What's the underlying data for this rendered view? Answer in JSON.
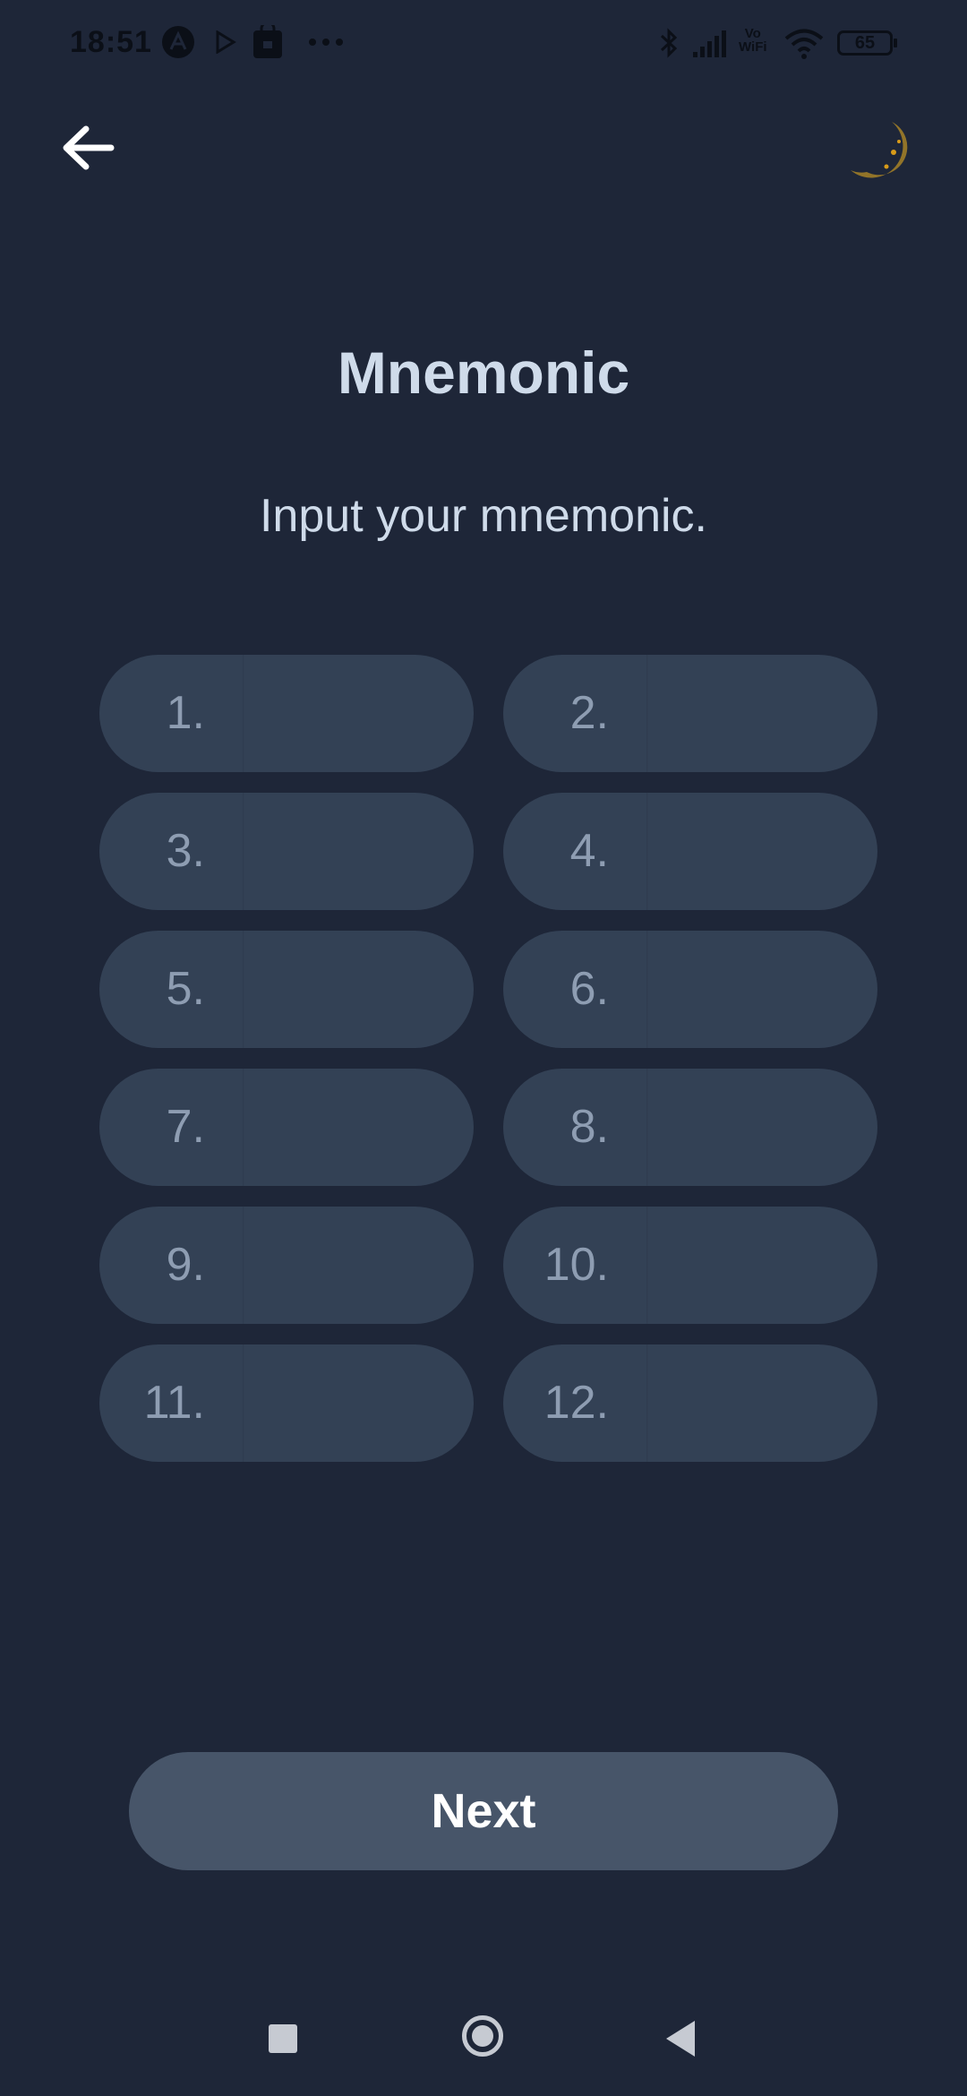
{
  "status_bar": {
    "time": "18:51",
    "battery": "65",
    "vowifi_line1": "Vo",
    "vowifi_line2": "WiFi"
  },
  "header": {
    "back_icon": "arrow-left-icon",
    "theme_icon": "crescent-moon-icon"
  },
  "page": {
    "title": "Mnemonic",
    "subtitle": "Input your mnemonic."
  },
  "words": [
    {
      "label": "1.",
      "value": ""
    },
    {
      "label": "2.",
      "value": ""
    },
    {
      "label": "3.",
      "value": ""
    },
    {
      "label": "4.",
      "value": ""
    },
    {
      "label": "5.",
      "value": ""
    },
    {
      "label": "6.",
      "value": ""
    },
    {
      "label": "7.",
      "value": ""
    },
    {
      "label": "8.",
      "value": ""
    },
    {
      "label": "9.",
      "value": ""
    },
    {
      "label": "10.",
      "value": ""
    },
    {
      "label": "11.",
      "value": ""
    },
    {
      "label": "12.",
      "value": ""
    }
  ],
  "actions": {
    "next_label": "Next"
  },
  "colors": {
    "background": "#1e2638",
    "field": "#334155",
    "button": "#475569",
    "title": "#cfdbea"
  }
}
